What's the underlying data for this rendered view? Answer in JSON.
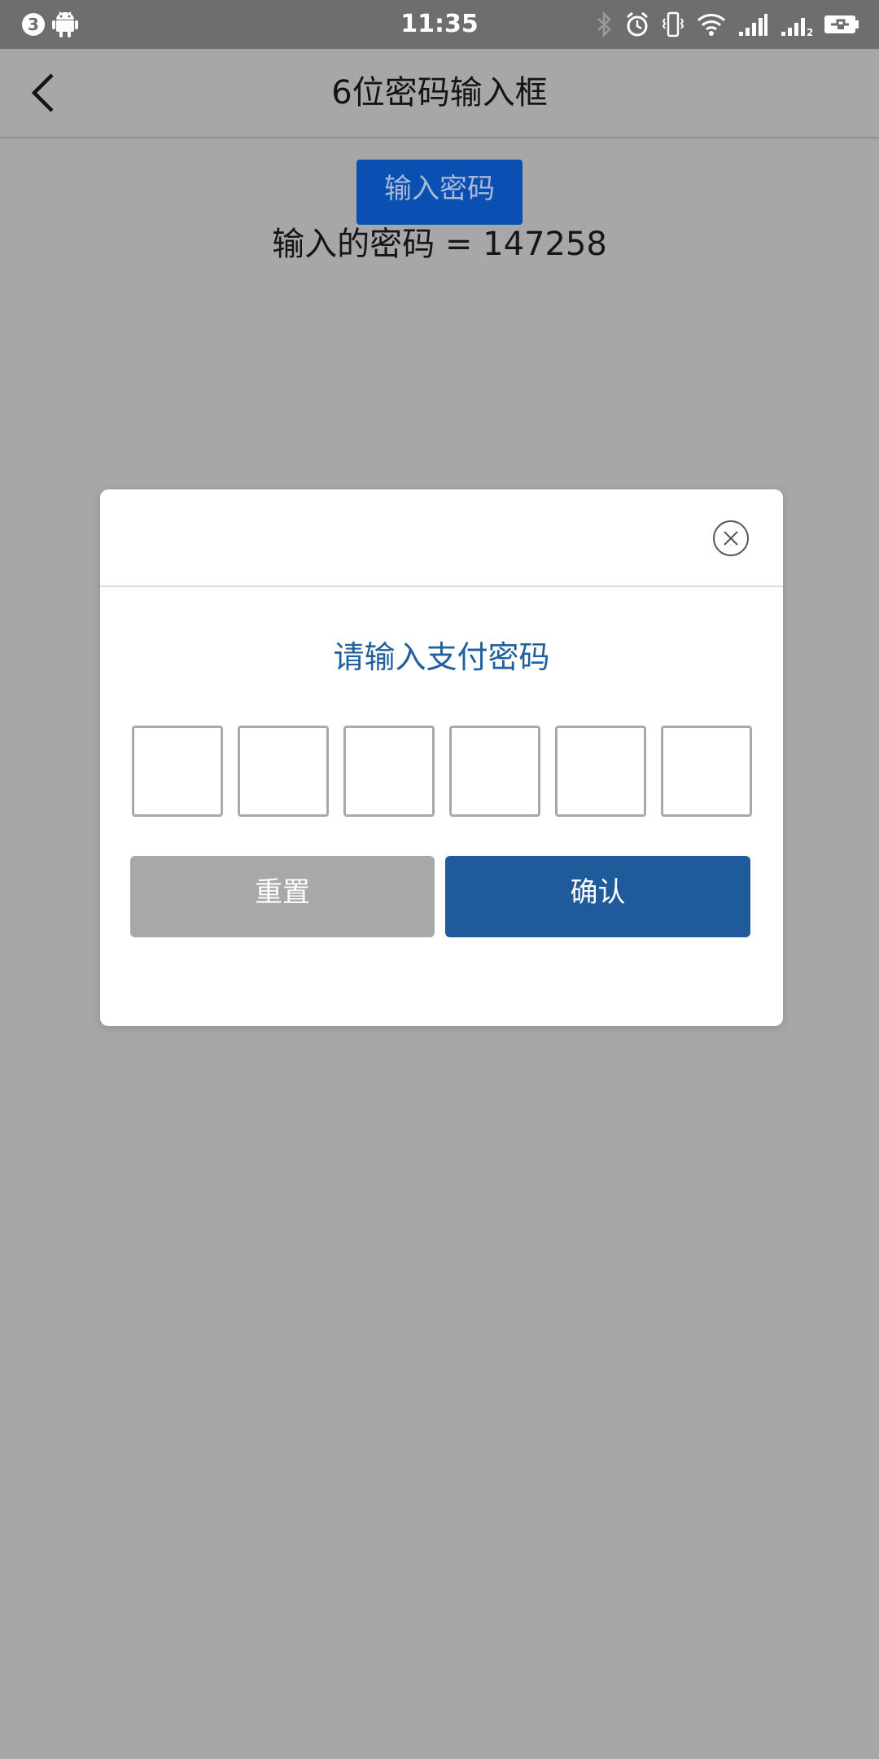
{
  "status_bar": {
    "notification_count": "3",
    "time": "11:35",
    "sim2_label": "2"
  },
  "title_bar": {
    "title": "6位密码输入框"
  },
  "content": {
    "open_button_label": "输入密码",
    "result_text": "输入的密码 = 147258"
  },
  "dialog": {
    "title": "请输入支付密码",
    "pin_boxes": [
      "",
      "",
      "",
      "",
      "",
      ""
    ],
    "reset_label": "重置",
    "confirm_label": "确认"
  },
  "colors": {
    "dim_overlay": "#a7a7aa",
    "status_bar": "#6e6e6e",
    "accent_blue": "#1f5a9b",
    "title_blue": "#21609e",
    "reset_gray": "#a8a8a8",
    "open_button_blue": "#0a4fb2"
  },
  "icons": {
    "status_left": [
      "notification-badge",
      "android-icon"
    ],
    "status_right": [
      "bluetooth-icon",
      "alarm-icon",
      "vibrate-icon",
      "wifi-icon",
      "signal-icon",
      "signal-sim2-icon",
      "battery-charging-icon"
    ],
    "nav": "back-arrow-icon",
    "dialog": "close-circle-icon"
  }
}
